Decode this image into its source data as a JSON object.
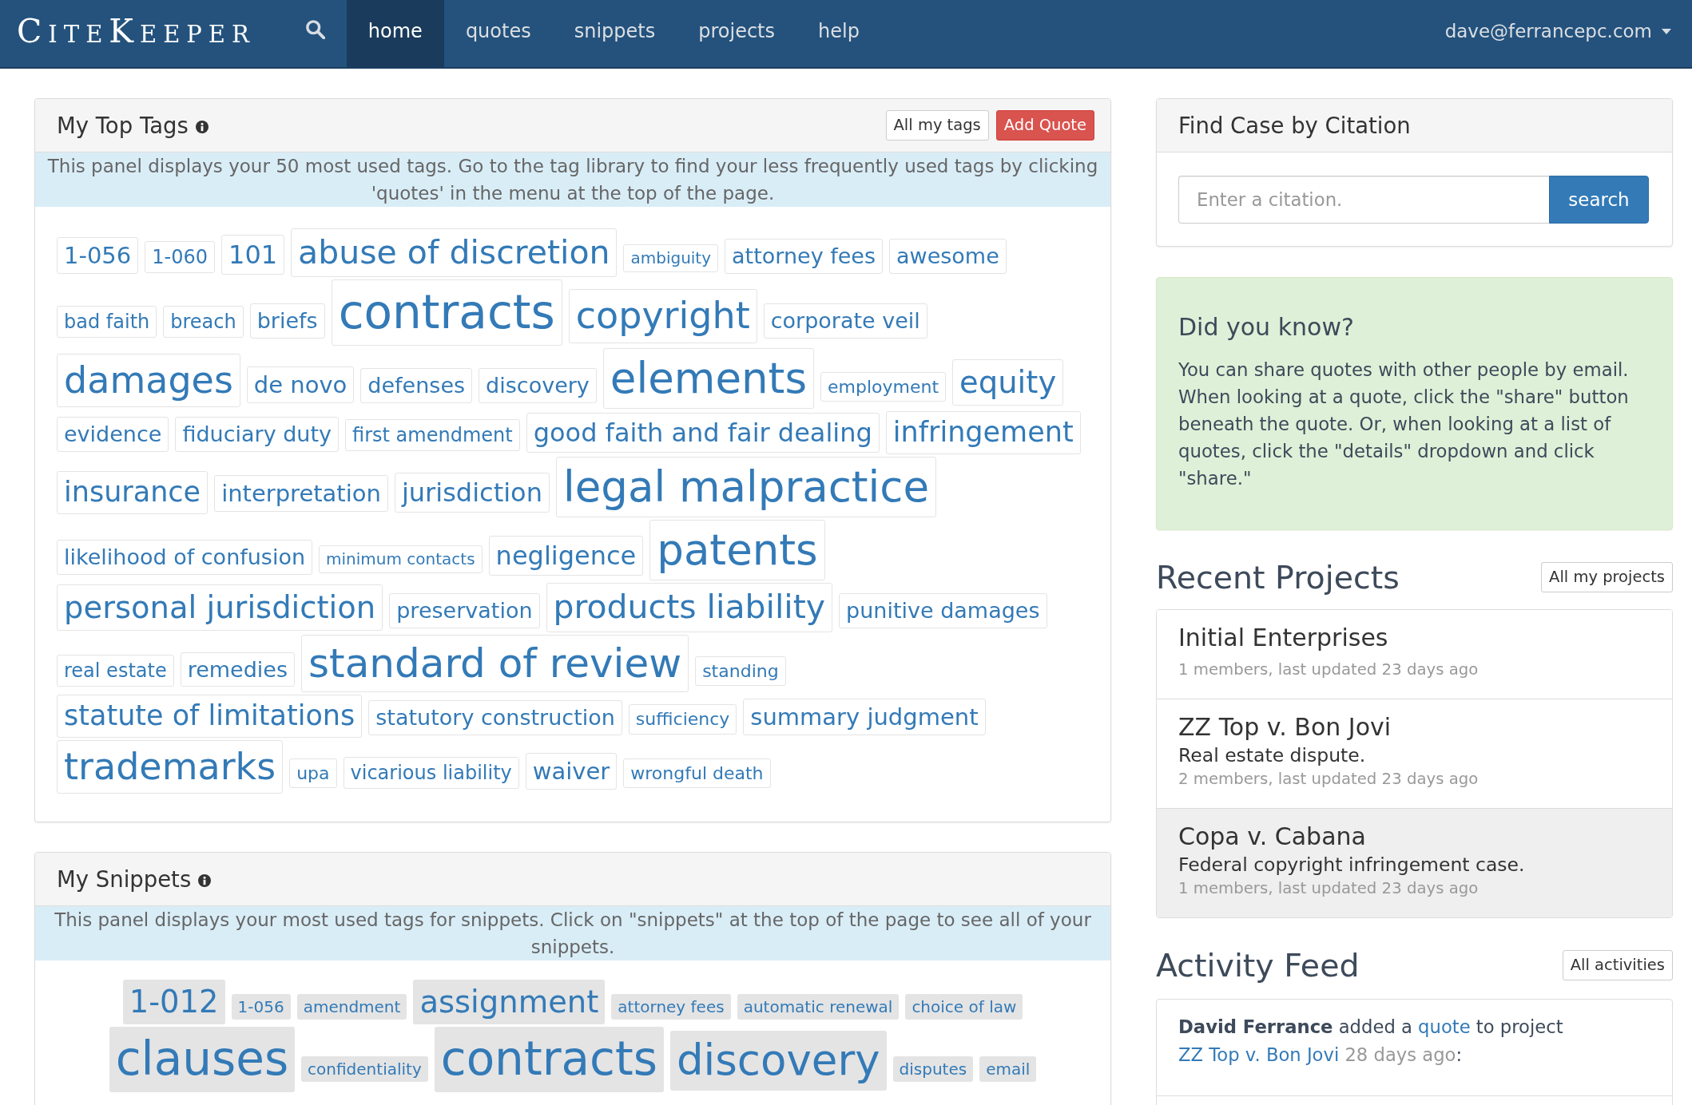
{
  "navbar": {
    "brand": "CiteKeeper",
    "links": [
      {
        "label": "home",
        "selected": true
      },
      {
        "label": "quotes",
        "selected": false
      },
      {
        "label": "snippets",
        "selected": false
      },
      {
        "label": "projects",
        "selected": false
      },
      {
        "label": "help",
        "selected": false
      }
    ],
    "user": "dave@ferrancepc.com"
  },
  "top_tags": {
    "title": "My Top Tags",
    "buttons": [
      {
        "label": "All my tags",
        "kind": "default"
      },
      {
        "label": "Add Quote",
        "kind": "danger"
      }
    ],
    "notice": "This panel displays your 50 most used tags. Go to the tag library to find your less frequently used tags by clicking 'quotes' in the menu at the top of the page.",
    "tags": [
      {
        "label": "1-056",
        "kind": "ml"
      },
      {
        "label": "1-060",
        "kind": "sm"
      },
      {
        "label": "101",
        "kind": "l"
      },
      {
        "label": "abuse of discretion",
        "kind": "h1"
      },
      {
        "label": "ambiguity",
        "kind": "xs"
      },
      {
        "label": "attorney fees",
        "kind": "m"
      },
      {
        "label": "awesome",
        "kind": "m"
      },
      {
        "label": "bad faith",
        "kind": "sm"
      },
      {
        "label": "breach",
        "kind": "sm"
      },
      {
        "label": "briefs",
        "kind": "m"
      },
      {
        "label": "contracts",
        "kind": "h5"
      },
      {
        "label": "copyright",
        "kind": "h2"
      },
      {
        "label": "corporate veil",
        "kind": "m"
      },
      {
        "label": "damages",
        "kind": "h2"
      },
      {
        "label": "de novo",
        "kind": "ml"
      },
      {
        "label": "defenses",
        "kind": "m"
      },
      {
        "label": "discovery",
        "kind": "m"
      },
      {
        "label": "elements",
        "kind": "h4"
      },
      {
        "label": "employment",
        "kind": "s"
      },
      {
        "label": "equity",
        "kind": "xxl"
      },
      {
        "label": "evidence",
        "kind": "m"
      },
      {
        "label": "fiduciary duty",
        "kind": "m"
      },
      {
        "label": "first amendment",
        "kind": "sm"
      },
      {
        "label": "good faith and fair dealing",
        "kind": "l"
      },
      {
        "label": "infringement",
        "kind": "xl"
      },
      {
        "label": "insurance",
        "kind": "xl"
      },
      {
        "label": "interpretation",
        "kind": "ml"
      },
      {
        "label": "jurisdiction",
        "kind": "l"
      },
      {
        "label": "legal malpractice",
        "kind": "h4"
      },
      {
        "label": "likelihood of confusion",
        "kind": "m"
      },
      {
        "label": "minimum contacts",
        "kind": "xs"
      },
      {
        "label": "negligence",
        "kind": "l"
      },
      {
        "label": "patents",
        "kind": "h4"
      },
      {
        "label": "personal jurisdiction",
        "kind": "xxl"
      },
      {
        "label": "preservation",
        "kind": "m"
      },
      {
        "label": "products liability",
        "kind": "h1"
      },
      {
        "label": "punitive damages",
        "kind": "m"
      },
      {
        "label": "real estate",
        "kind": "sm"
      },
      {
        "label": "remedies",
        "kind": "m"
      },
      {
        "label": "standard of review",
        "kind": "h3"
      },
      {
        "label": "standing",
        "kind": "s"
      },
      {
        "label": "statute of limitations",
        "kind": "xl"
      },
      {
        "label": "statutory construction",
        "kind": "m"
      },
      {
        "label": "sufficiency",
        "kind": "s"
      },
      {
        "label": "summary judgment",
        "kind": "ml"
      },
      {
        "label": "trademarks",
        "kind": "h2"
      },
      {
        "label": "upa",
        "kind": "s"
      },
      {
        "label": "vicarious liability",
        "kind": "sm"
      },
      {
        "label": "waiver",
        "kind": "ml"
      },
      {
        "label": "wrongful death",
        "kind": "s"
      }
    ]
  },
  "snippets": {
    "title": "My Snippets",
    "notice": "This panel displays your most used tags for snippets. Click on \"snippets\" at the top of the page to see all of your snippets.",
    "tags": [
      {
        "label": "1-012",
        "kind": "xxl"
      },
      {
        "label": "1-056",
        "kind": "xs"
      },
      {
        "label": "amendment",
        "kind": "xs"
      },
      {
        "label": "assignment",
        "kind": "xxl"
      },
      {
        "label": "attorney fees",
        "kind": "xs"
      },
      {
        "label": "automatic renewal",
        "kind": "xs"
      },
      {
        "label": "choice of law",
        "kind": "xs"
      },
      {
        "label": "clauses",
        "kind": "h5"
      },
      {
        "label": "confidentiality",
        "kind": "xs"
      },
      {
        "label": "contracts",
        "kind": "h5"
      },
      {
        "label": "discovery",
        "kind": "h4"
      },
      {
        "label": "disputes",
        "kind": "xs"
      },
      {
        "label": "email",
        "kind": "xs"
      }
    ]
  },
  "citation_search": {
    "title": "Find Case by Citation",
    "placeholder": "Enter a citation.",
    "button": "search"
  },
  "tip": {
    "title": "Did you know?",
    "text": "You can share quotes with other people by email. When looking at a quote, click the \"share\" button beneath the quote. Or, when looking at a list of quotes, click the \"details\" dropdown and click \"share.\""
  },
  "recent_projects": {
    "title": "Recent Projects",
    "button": "All my projects",
    "items": [
      {
        "name": "Initial Enterprises",
        "meta": "1 members, last updated 23 days ago",
        "highlighted": false
      },
      {
        "name": "ZZ Top v. Bon Jovi",
        "description": "Real estate dispute.",
        "meta": "2 members, last updated 23 days ago",
        "highlighted": false
      },
      {
        "name": "Copa v. Cabana",
        "description": "Federal copyright infringement case.",
        "meta": "1 members, last updated 23 days ago",
        "highlighted": true
      }
    ]
  },
  "activity_feed": {
    "title": "Activity Feed",
    "button": "All activities",
    "items": [
      {
        "user": "David Ferrance",
        "action": "added a",
        "object": "quote",
        "connector": "to project",
        "project": "ZZ Top v. Bon Jovi",
        "time": "28 days ago",
        "end": ":"
      }
    ]
  }
}
